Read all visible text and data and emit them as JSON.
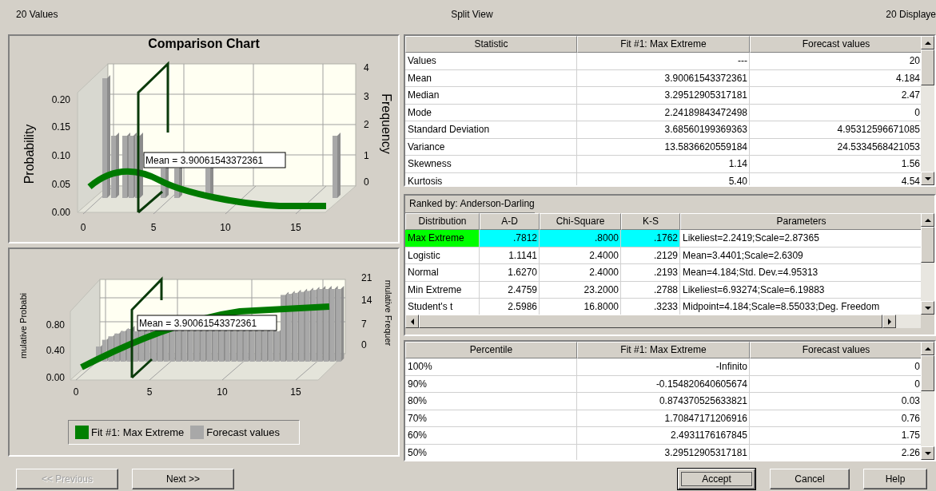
{
  "header": {
    "left": "20 Values",
    "center": "Split View",
    "right": "20 Displaye"
  },
  "charts": [
    {
      "kind": "density",
      "title": "Comparison Chart",
      "y_left_title": "Probability",
      "y_right_title": "Frequency",
      "y_left_ticks": [
        "0.20",
        "0.15",
        "0.10",
        "0.05",
        "0.00"
      ],
      "y_right_ticks": [
        "4",
        "3",
        "2",
        "1",
        "0"
      ],
      "x_ticks": [
        "0",
        "5",
        "10",
        "15"
      ],
      "mean_label": "Mean = 3.90061543372361"
    },
    {
      "kind": "cumulative",
      "y_left_title": "mulative Probabi",
      "y_right_title": "mulative Frequer",
      "y_left_ticks": [
        "0.80",
        "0.40",
        "0.00"
      ],
      "y_right_ticks": [
        "21",
        "14",
        "7",
        "0"
      ],
      "x_ticks": [
        "0",
        "5",
        "10",
        "15"
      ],
      "mean_label": "Mean = 3.90061543372361",
      "legend": [
        {
          "label": "Fit #1: Max Extreme",
          "color": "#008000"
        },
        {
          "label": "Forecast values",
          "color": "#a8a8a8"
        }
      ]
    }
  ],
  "statistics_table": {
    "columns": [
      "Statistic",
      "Fit #1: Max Extreme",
      "Forecast values"
    ],
    "rows": [
      [
        "Values",
        "---",
        "20"
      ],
      [
        "Mean",
        "3.90061543372361",
        "4.184"
      ],
      [
        "Median",
        "3.29512905317181",
        "2.47"
      ],
      [
        "Mode",
        "2.24189843472498",
        "0"
      ],
      [
        "Standard Deviation",
        "3.68560199369363",
        "4.95312596671085"
      ],
      [
        "Variance",
        "13.5836620559184",
        "24.5334568421053"
      ],
      [
        "Skewness",
        "1.14",
        "1.56"
      ],
      [
        "Kurtosis",
        "5.40",
        "4.54"
      ]
    ]
  },
  "ranking_table": {
    "title": "Ranked by: Anderson-Darling",
    "columns": [
      "Distribution",
      "A-D",
      "Chi-Square",
      "K-S",
      "Parameters"
    ],
    "rows": [
      {
        "cells": [
          "Max Extreme",
          ".7812",
          ".8000",
          ".1762",
          "Likeliest=2.2419;Scale=2.87365"
        ],
        "best_fit": true
      },
      {
        "cells": [
          "Logistic",
          "1.1141",
          "2.4000",
          ".2129",
          "Mean=3.4401;Scale=2.6309"
        ],
        "best_fit": false
      },
      {
        "cells": [
          "Normal",
          "1.6270",
          "2.4000",
          ".2193",
          "Mean=4.184;Std. Dev.=4.95313"
        ],
        "best_fit": false
      },
      {
        "cells": [
          "Min Extreme",
          "2.4759",
          "23.2000",
          ".2788",
          "Likeliest=6.93274;Scale=6.19883"
        ],
        "best_fit": false
      },
      {
        "cells": [
          "Student's t",
          "2.5986",
          "16.8000",
          ".3233",
          "Midpoint=4.184;Scale=8.55033;Deg. Freedom"
        ],
        "best_fit": false
      }
    ]
  },
  "percentile_table": {
    "columns": [
      "Percentile",
      "Fit #1: Max Extreme",
      "Forecast values"
    ],
    "rows": [
      [
        "100%",
        "-Infinito",
        "0"
      ],
      [
        "90%",
        "-0.154820640605674",
        "0"
      ],
      [
        "80%",
        "0.874370525633821",
        "0.03"
      ],
      [
        "70%",
        "1.70847171206916",
        "0.76"
      ],
      [
        "60%",
        "2.4931176167845",
        "1.75"
      ],
      [
        "50%",
        "3.29512905317181",
        "2.26"
      ]
    ]
  },
  "buttons": [
    {
      "label": "<< Previous",
      "disabled": true,
      "focused": false
    },
    {
      "label": "Next >>",
      "disabled": false,
      "focused": false
    },
    {
      "label": "Accept",
      "disabled": false,
      "focused": true
    },
    {
      "label": "Cancel",
      "disabled": false,
      "focused": false
    },
    {
      "label": "Help",
      "disabled": false,
      "focused": false
    }
  ]
}
